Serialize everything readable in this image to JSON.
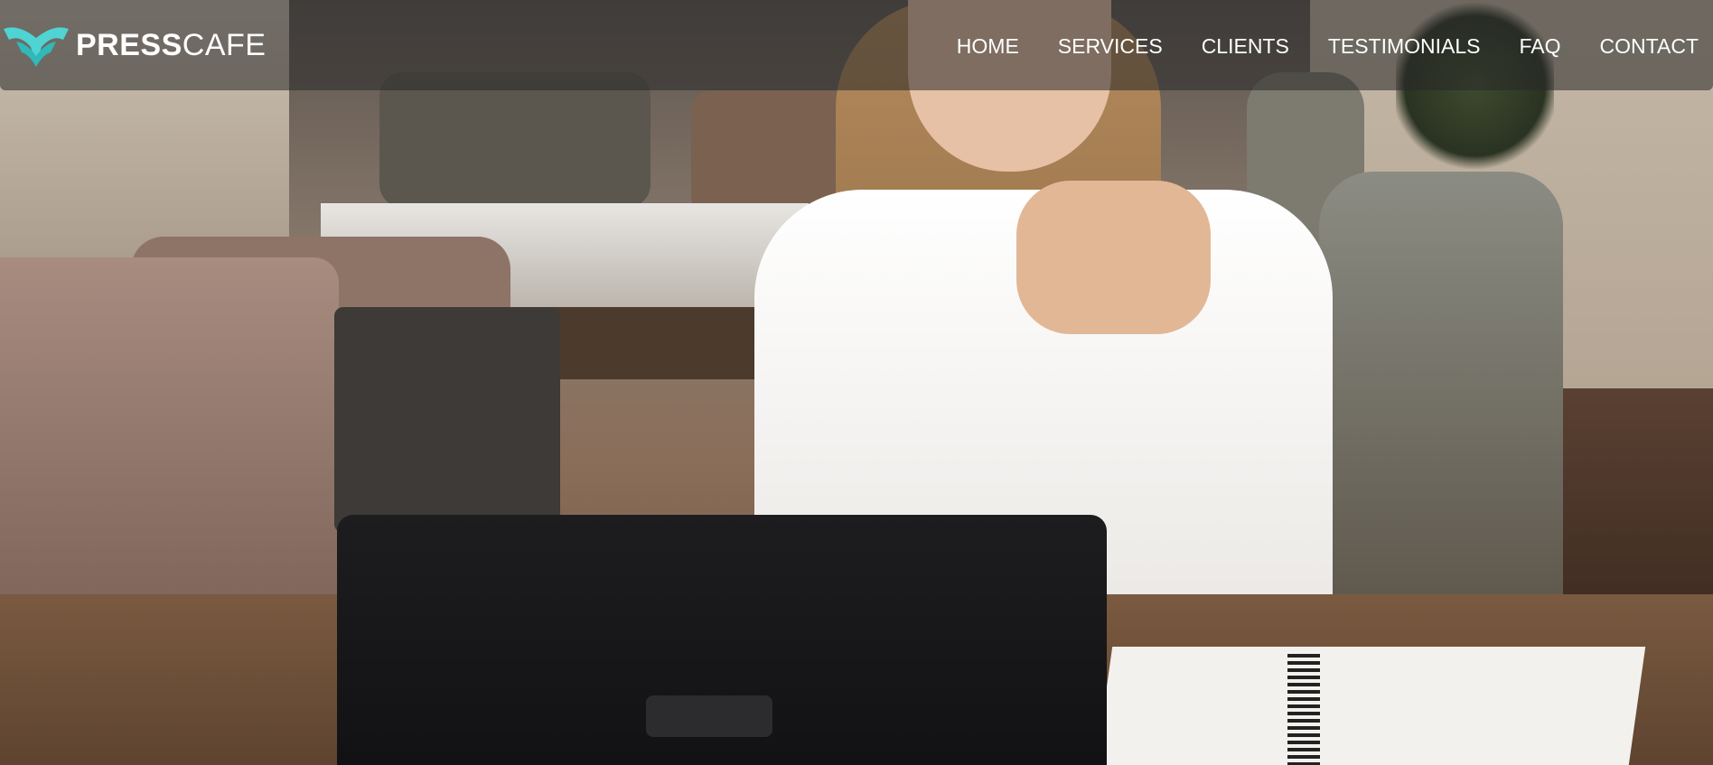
{
  "brand": {
    "name_bold": "PRESS",
    "name_light": "CAFE",
    "accent_color": "#4fd3d3"
  },
  "nav": {
    "items": [
      {
        "label": "HOME"
      },
      {
        "label": "SERVICES"
      },
      {
        "label": "CLIENTS"
      },
      {
        "label": "TESTIMONIALS"
      },
      {
        "label": "FAQ"
      },
      {
        "label": "CONTACT"
      }
    ]
  },
  "hero": {
    "image": "hero-photo"
  }
}
